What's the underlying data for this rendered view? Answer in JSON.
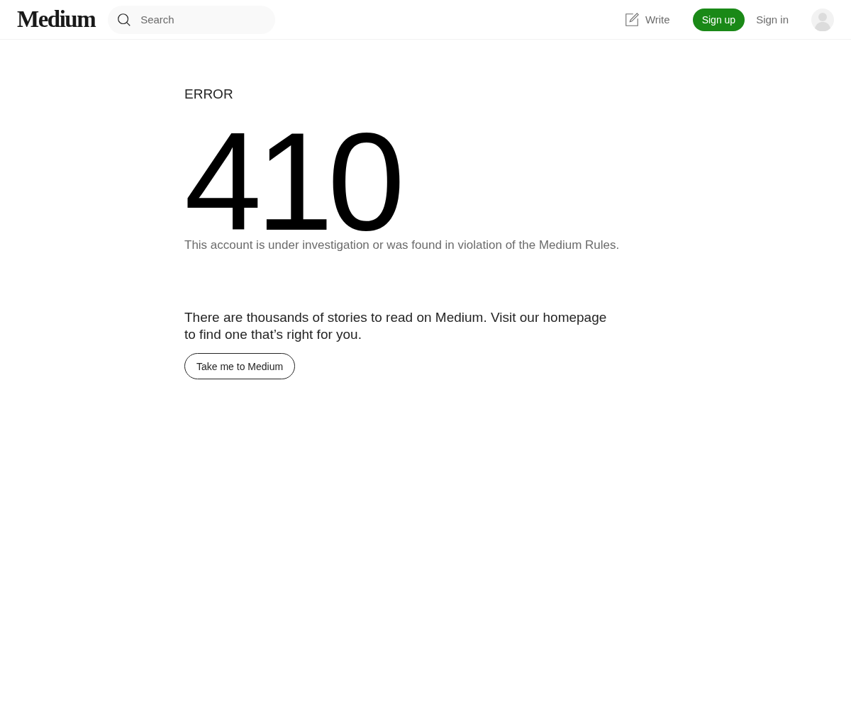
{
  "header": {
    "logo": "Medium",
    "search": {
      "placeholder": "Search"
    },
    "write": "Write",
    "sign_up": "Sign up",
    "sign_in": "Sign in"
  },
  "error": {
    "label": "ERROR",
    "code": "410",
    "message": "This account is under investigation or was found in violation of the Medium Rules."
  },
  "suggestion": {
    "text": "There are thousands of stories to read on Medium. Visit our homepage to find one that’s right for you.",
    "button": "Take me to Medium"
  }
}
